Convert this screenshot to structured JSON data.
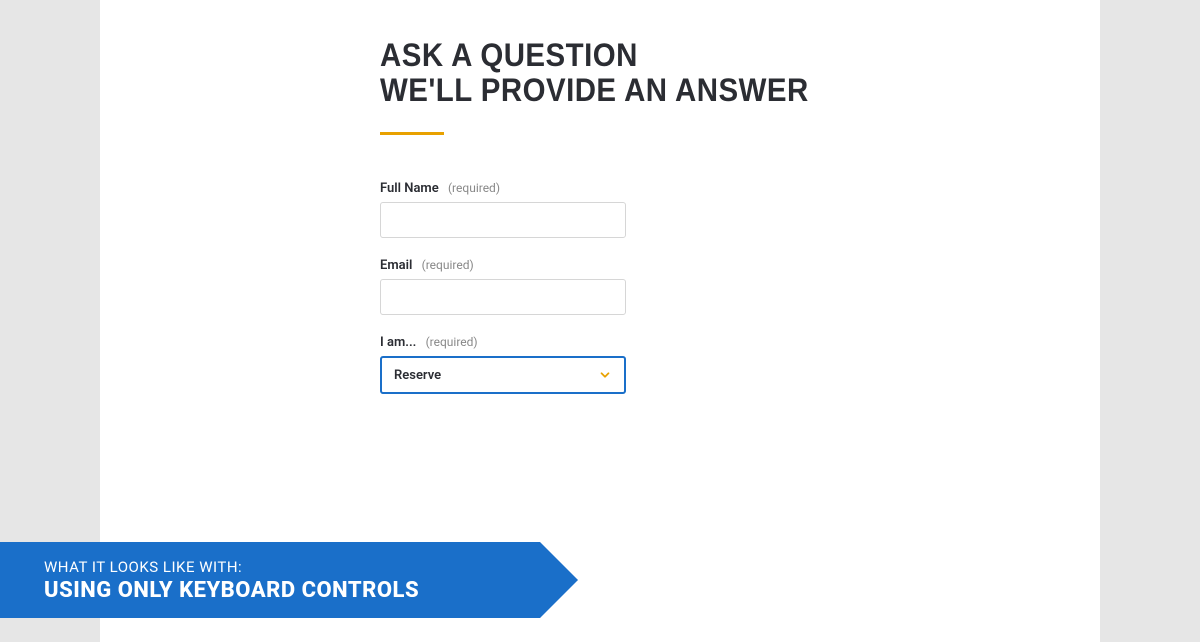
{
  "heading": {
    "line1": "ASK A QUESTION",
    "line2": "WE'LL PROVIDE AN ANSWER"
  },
  "form": {
    "fullname": {
      "label": "Full Name",
      "required_text": "(required)",
      "value": ""
    },
    "email": {
      "label": "Email",
      "required_text": "(required)",
      "value": ""
    },
    "iam": {
      "label": "I am...",
      "required_text": "(required)",
      "selected": "Reserve"
    }
  },
  "caption": {
    "line1": "WHAT IT LOOKS LIKE WITH:",
    "line2": "USING ONLY KEYBOARD CONTROLS"
  },
  "colors": {
    "accent": "#e8a100",
    "banner": "#1a6fc9",
    "focus_border": "#1a6fc9"
  }
}
